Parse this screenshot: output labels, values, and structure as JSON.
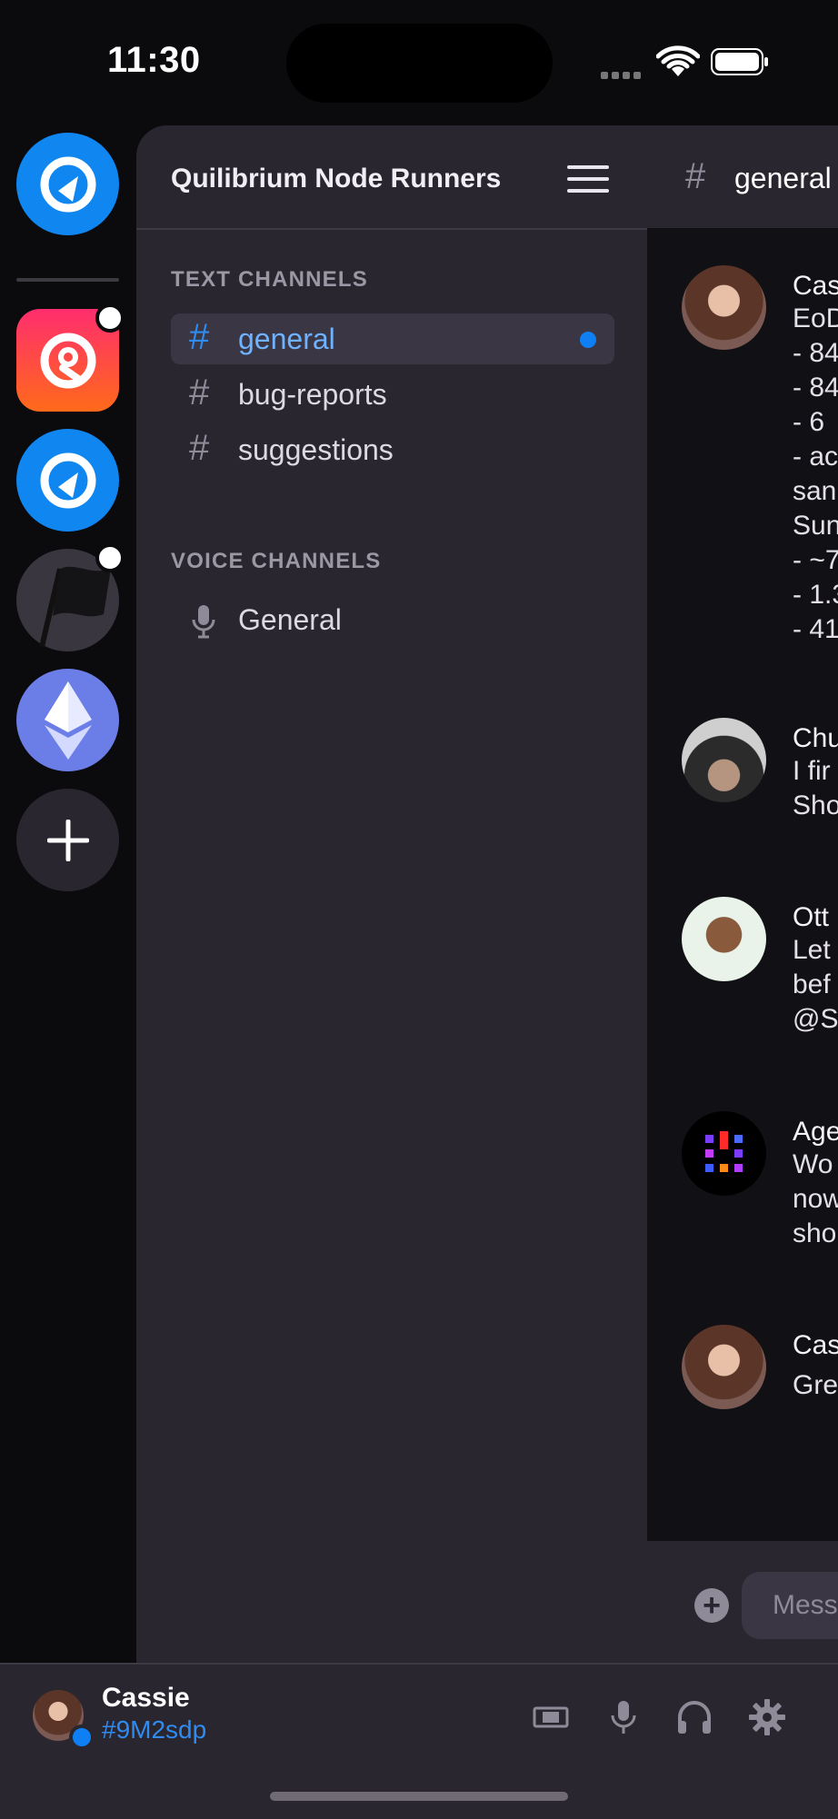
{
  "status_bar": {
    "time": "11:30"
  },
  "servers": [
    {
      "name": "Quilibrium",
      "color": "#0f86f0",
      "unread": false,
      "selected": true
    },
    {
      "name": "Quilibrium Community",
      "color": "#ff2a5a",
      "unread": true
    },
    {
      "name": "Quilibrium Node Runners",
      "color": "#0f86f0",
      "unread": false
    },
    {
      "name": "Flag Server",
      "color": "#1e1c22",
      "unread": true
    },
    {
      "name": "Ethereum",
      "color": "#6b7ee8",
      "unread": false
    },
    {
      "name": "Add a Server",
      "color": "#2a2630"
    }
  ],
  "server_header": {
    "name": "Quilibrium Node Runners"
  },
  "text_channels": {
    "label": "TEXT CHANNELS",
    "items": [
      {
        "name": "general",
        "active": true,
        "unread": true
      },
      {
        "name": "bug-reports",
        "active": false
      },
      {
        "name": "suggestions",
        "active": false
      }
    ]
  },
  "voice_channels": {
    "label": "VOICE CHANNELS",
    "items": [
      {
        "name": "General"
      }
    ]
  },
  "chat": {
    "channel": "general",
    "input_placeholder": "Mess",
    "messages": [
      {
        "author": "Cas",
        "lines": [
          "EoD",
          "- 84",
          "- 84",
          "- 6",
          "- ac",
          "san",
          "Sun",
          "- ~7",
          "- 1.3",
          "- 41"
        ]
      },
      {
        "author": "Chu",
        "lines": [
          "I fir",
          "Sho"
        ]
      },
      {
        "author": "Ott",
        "lines": [
          "Let",
          "bef",
          "@S"
        ]
      },
      {
        "author": "Age",
        "lines": [
          "Wo",
          "now",
          "sho"
        ]
      },
      {
        "author": "Cas",
        "lines": [
          "Gre"
        ]
      }
    ]
  },
  "user": {
    "name": "Cassie",
    "tag": "#9M2sdp"
  },
  "colors": {
    "accent": "#0f7ff4",
    "panel": "#2a2630",
    "chat_bg": "#111014"
  }
}
